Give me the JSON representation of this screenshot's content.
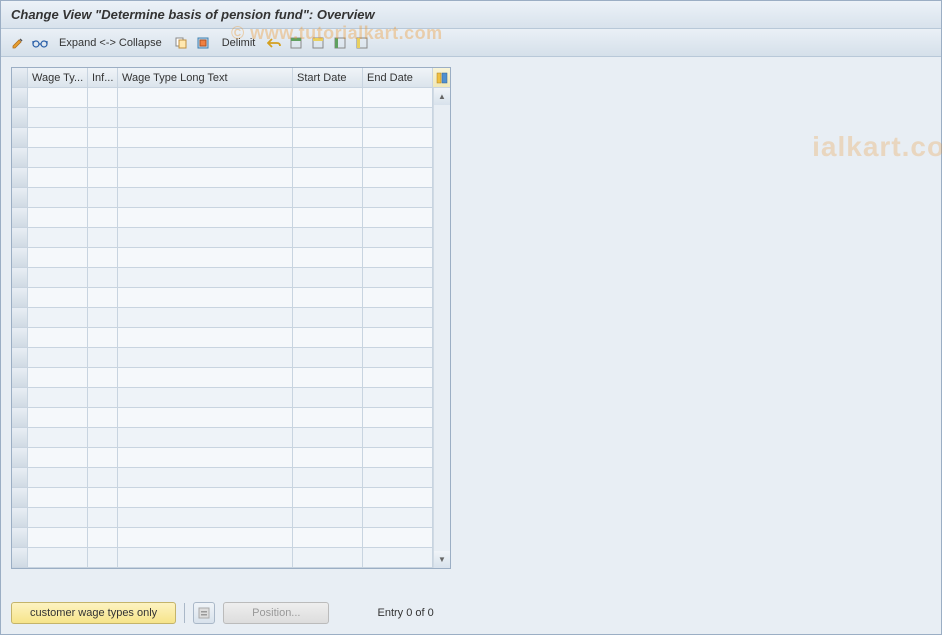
{
  "title": "Change View \"Determine basis of pension fund\": Overview",
  "toolbar": {
    "expand_collapse": "Expand <-> Collapse",
    "delimit": "Delimit"
  },
  "table": {
    "columns": [
      {
        "key": "wage_type",
        "label": "Wage Ty...",
        "width": "col-wage"
      },
      {
        "key": "inf",
        "label": "Inf...",
        "width": "col-inf"
      },
      {
        "key": "long_text",
        "label": "Wage Type Long Text",
        "width": "col-long"
      },
      {
        "key": "start_date",
        "label": "Start Date",
        "width": "col-start"
      },
      {
        "key": "end_date",
        "label": "End Date",
        "width": "col-end"
      }
    ],
    "row_count": 24,
    "rows": []
  },
  "footer": {
    "customer_btn": "customer wage types only",
    "position_btn": "Position...",
    "entry_text": "Entry 0 of 0"
  },
  "watermark": "© www.tutorialkart.com",
  "watermark2": "ialkart.com",
  "colors": {
    "accent_yellow": "#f6e48a",
    "panel_bg": "#e8eef4",
    "border": "#9baec4"
  }
}
